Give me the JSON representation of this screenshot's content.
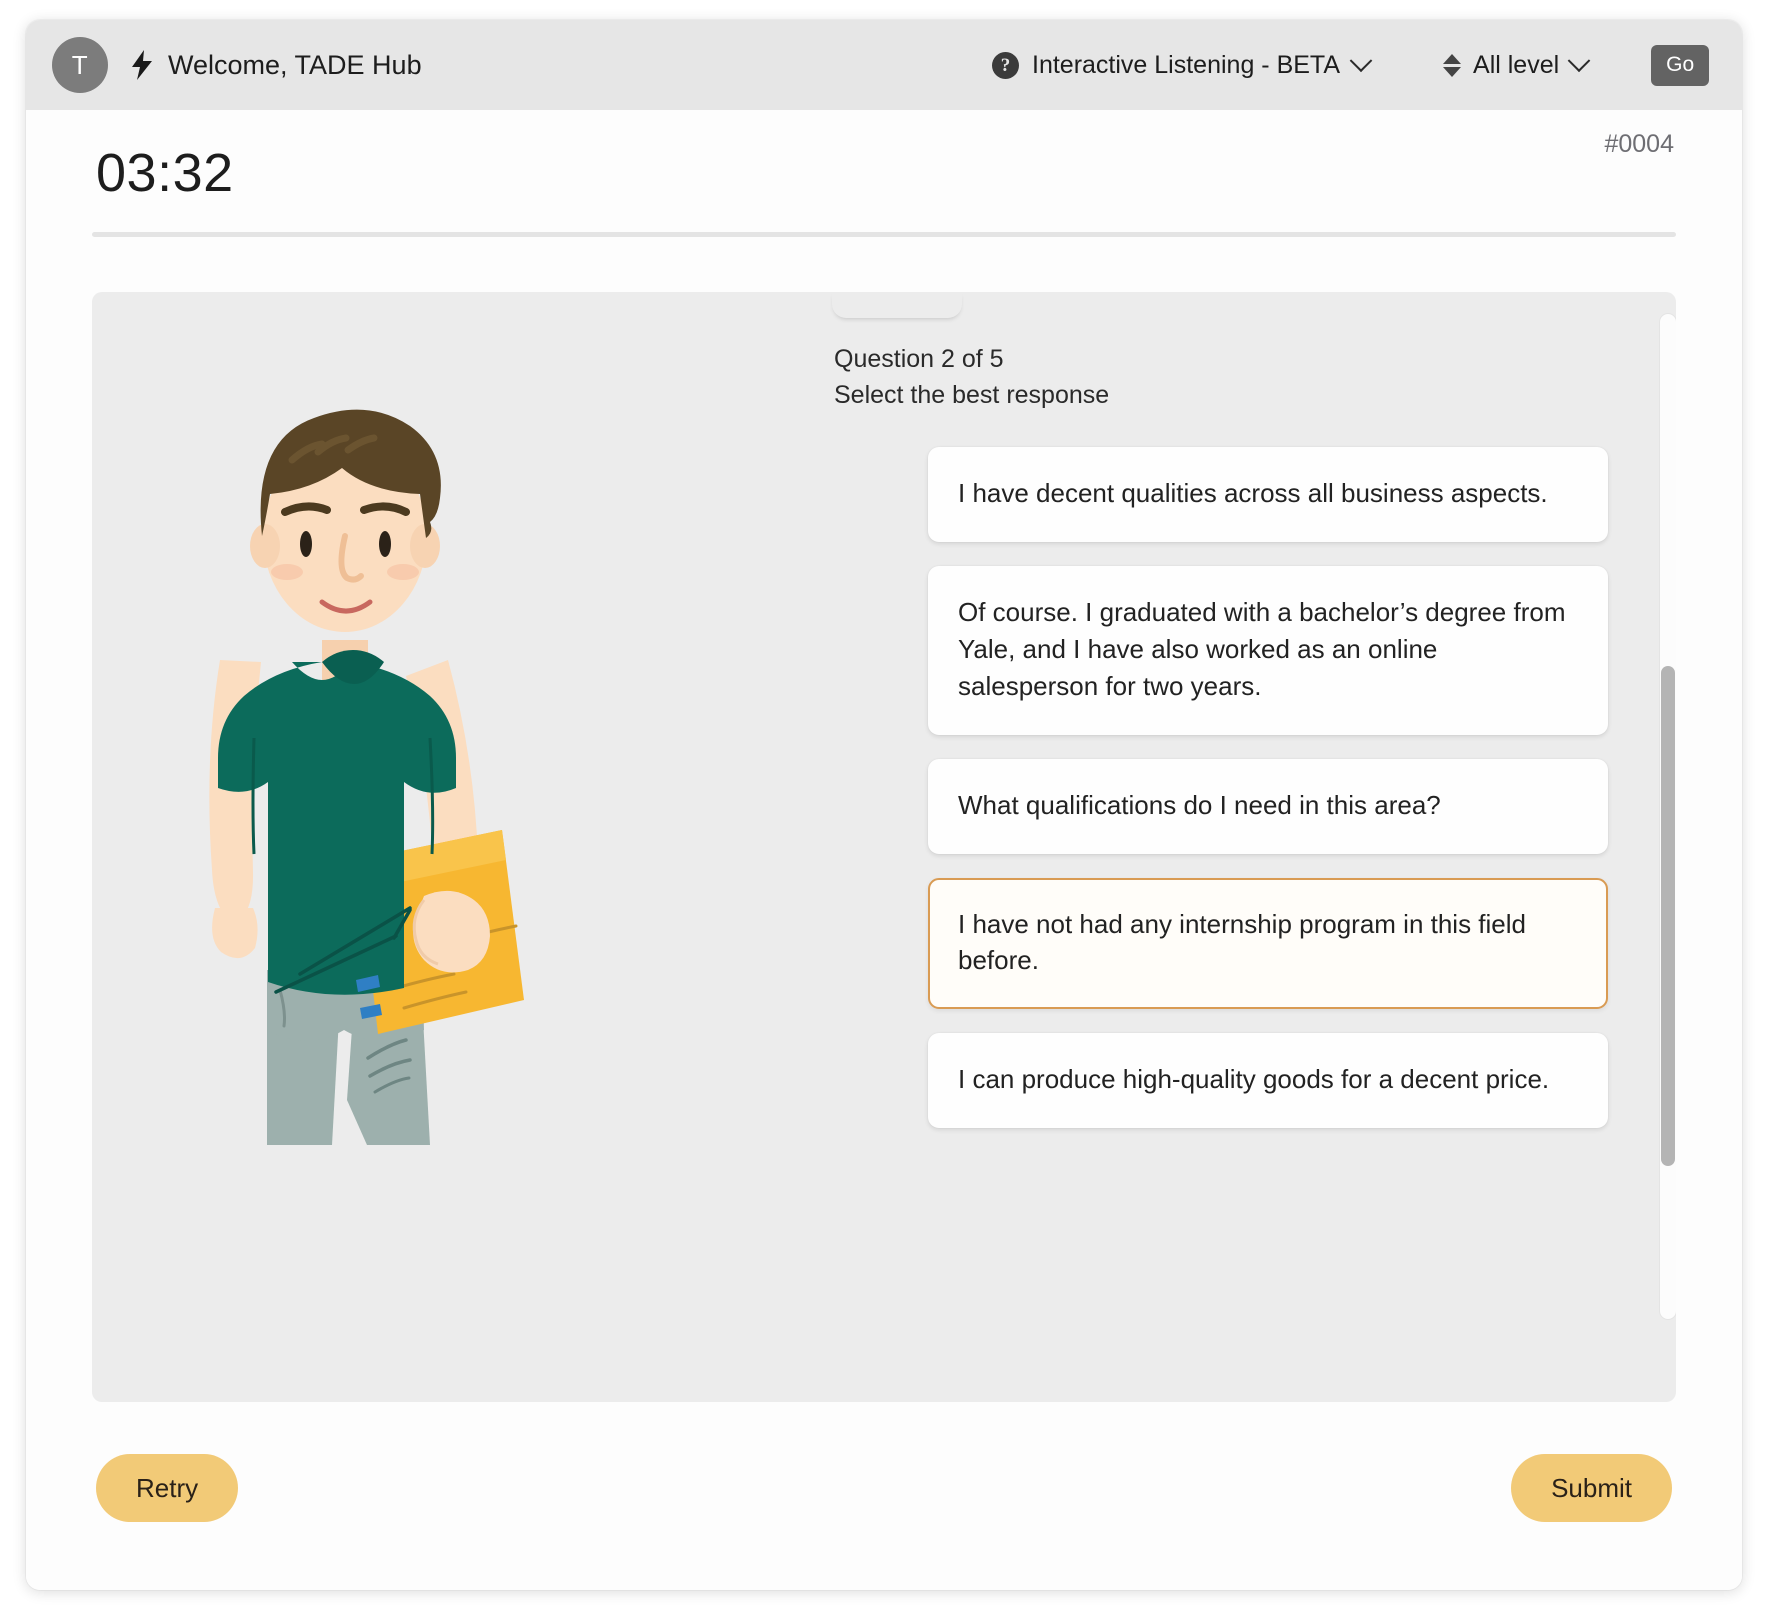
{
  "header": {
    "avatar_initial": "T",
    "bolt_icon": "lightning-bolt-icon",
    "welcome_text": "Welcome, TADE Hub",
    "help_icon": "question-mark-circle-icon",
    "mode_label": "Interactive Listening - BETA",
    "mode_chevron": "chevron-down-icon",
    "level_icon": "sort-updown-icon",
    "level_label": "All level",
    "level_chevron": "chevron-down-icon",
    "go_label": "Go"
  },
  "status": {
    "timer": "03:32",
    "question_id": "#0004"
  },
  "exercise": {
    "question_count": "Question 2 of 5",
    "prompt": "Select the best response",
    "options": [
      {
        "text": "I have decent qualities across all business aspects.",
        "selected": false
      },
      {
        "text": "Of course. I graduated with a bachelor’s degree from Yale, and I have also worked as an online salesperson for two years.",
        "selected": false
      },
      {
        "text": "What qualifications do I need in this area?",
        "selected": false
      },
      {
        "text": "I have not had any internship program in this field before.",
        "selected": true
      },
      {
        "text": "I can produce high-quality goods for a decent price.",
        "selected": false
      }
    ],
    "illustration": "standing-young-man-holding-folder-illustration"
  },
  "footer": {
    "retry_label": "Retry",
    "submit_label": "Submit"
  },
  "colors": {
    "topbar_bg": "#e6e6e6",
    "panel_bg": "#ececec",
    "accent_button": "#f2ca77",
    "selected_border": "#d99b53",
    "go_button": "#636363",
    "shirt_green": "#0c6b5b",
    "folder_yellow": "#f7b731",
    "shorts_gray": "#9db0ad",
    "hair_brown": "#5a4526",
    "skin": "#fbddc0"
  }
}
